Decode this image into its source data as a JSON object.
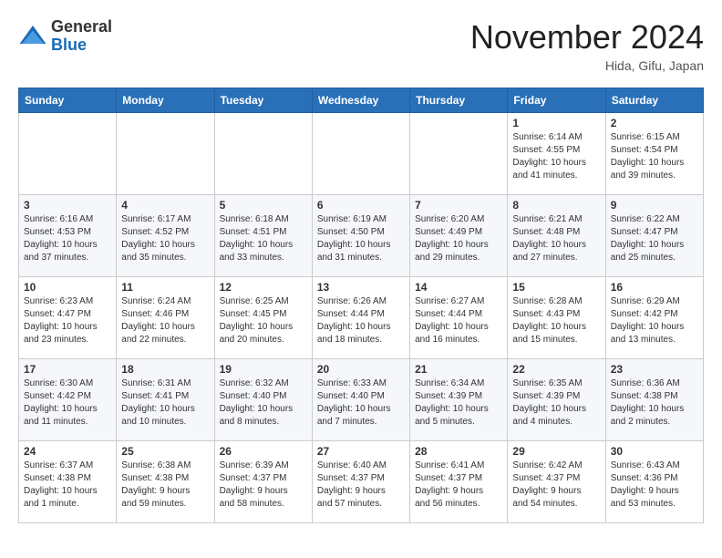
{
  "header": {
    "logo_general": "General",
    "logo_blue": "Blue",
    "month_title": "November 2024",
    "location": "Hida, Gifu, Japan"
  },
  "weekdays": [
    "Sunday",
    "Monday",
    "Tuesday",
    "Wednesday",
    "Thursday",
    "Friday",
    "Saturday"
  ],
  "weeks": [
    [
      {
        "day": "",
        "info": ""
      },
      {
        "day": "",
        "info": ""
      },
      {
        "day": "",
        "info": ""
      },
      {
        "day": "",
        "info": ""
      },
      {
        "day": "",
        "info": ""
      },
      {
        "day": "1",
        "info": "Sunrise: 6:14 AM\nSunset: 4:55 PM\nDaylight: 10 hours\nand 41 minutes."
      },
      {
        "day": "2",
        "info": "Sunrise: 6:15 AM\nSunset: 4:54 PM\nDaylight: 10 hours\nand 39 minutes."
      }
    ],
    [
      {
        "day": "3",
        "info": "Sunrise: 6:16 AM\nSunset: 4:53 PM\nDaylight: 10 hours\nand 37 minutes."
      },
      {
        "day": "4",
        "info": "Sunrise: 6:17 AM\nSunset: 4:52 PM\nDaylight: 10 hours\nand 35 minutes."
      },
      {
        "day": "5",
        "info": "Sunrise: 6:18 AM\nSunset: 4:51 PM\nDaylight: 10 hours\nand 33 minutes."
      },
      {
        "day": "6",
        "info": "Sunrise: 6:19 AM\nSunset: 4:50 PM\nDaylight: 10 hours\nand 31 minutes."
      },
      {
        "day": "7",
        "info": "Sunrise: 6:20 AM\nSunset: 4:49 PM\nDaylight: 10 hours\nand 29 minutes."
      },
      {
        "day": "8",
        "info": "Sunrise: 6:21 AM\nSunset: 4:48 PM\nDaylight: 10 hours\nand 27 minutes."
      },
      {
        "day": "9",
        "info": "Sunrise: 6:22 AM\nSunset: 4:47 PM\nDaylight: 10 hours\nand 25 minutes."
      }
    ],
    [
      {
        "day": "10",
        "info": "Sunrise: 6:23 AM\nSunset: 4:47 PM\nDaylight: 10 hours\nand 23 minutes."
      },
      {
        "day": "11",
        "info": "Sunrise: 6:24 AM\nSunset: 4:46 PM\nDaylight: 10 hours\nand 22 minutes."
      },
      {
        "day": "12",
        "info": "Sunrise: 6:25 AM\nSunset: 4:45 PM\nDaylight: 10 hours\nand 20 minutes."
      },
      {
        "day": "13",
        "info": "Sunrise: 6:26 AM\nSunset: 4:44 PM\nDaylight: 10 hours\nand 18 minutes."
      },
      {
        "day": "14",
        "info": "Sunrise: 6:27 AM\nSunset: 4:44 PM\nDaylight: 10 hours\nand 16 minutes."
      },
      {
        "day": "15",
        "info": "Sunrise: 6:28 AM\nSunset: 4:43 PM\nDaylight: 10 hours\nand 15 minutes."
      },
      {
        "day": "16",
        "info": "Sunrise: 6:29 AM\nSunset: 4:42 PM\nDaylight: 10 hours\nand 13 minutes."
      }
    ],
    [
      {
        "day": "17",
        "info": "Sunrise: 6:30 AM\nSunset: 4:42 PM\nDaylight: 10 hours\nand 11 minutes."
      },
      {
        "day": "18",
        "info": "Sunrise: 6:31 AM\nSunset: 4:41 PM\nDaylight: 10 hours\nand 10 minutes."
      },
      {
        "day": "19",
        "info": "Sunrise: 6:32 AM\nSunset: 4:40 PM\nDaylight: 10 hours\nand 8 minutes."
      },
      {
        "day": "20",
        "info": "Sunrise: 6:33 AM\nSunset: 4:40 PM\nDaylight: 10 hours\nand 7 minutes."
      },
      {
        "day": "21",
        "info": "Sunrise: 6:34 AM\nSunset: 4:39 PM\nDaylight: 10 hours\nand 5 minutes."
      },
      {
        "day": "22",
        "info": "Sunrise: 6:35 AM\nSunset: 4:39 PM\nDaylight: 10 hours\nand 4 minutes."
      },
      {
        "day": "23",
        "info": "Sunrise: 6:36 AM\nSunset: 4:38 PM\nDaylight: 10 hours\nand 2 minutes."
      }
    ],
    [
      {
        "day": "24",
        "info": "Sunrise: 6:37 AM\nSunset: 4:38 PM\nDaylight: 10 hours\nand 1 minute."
      },
      {
        "day": "25",
        "info": "Sunrise: 6:38 AM\nSunset: 4:38 PM\nDaylight: 9 hours\nand 59 minutes."
      },
      {
        "day": "26",
        "info": "Sunrise: 6:39 AM\nSunset: 4:37 PM\nDaylight: 9 hours\nand 58 minutes."
      },
      {
        "day": "27",
        "info": "Sunrise: 6:40 AM\nSunset: 4:37 PM\nDaylight: 9 hours\nand 57 minutes."
      },
      {
        "day": "28",
        "info": "Sunrise: 6:41 AM\nSunset: 4:37 PM\nDaylight: 9 hours\nand 56 minutes."
      },
      {
        "day": "29",
        "info": "Sunrise: 6:42 AM\nSunset: 4:37 PM\nDaylight: 9 hours\nand 54 minutes."
      },
      {
        "day": "30",
        "info": "Sunrise: 6:43 AM\nSunset: 4:36 PM\nDaylight: 9 hours\nand 53 minutes."
      }
    ]
  ]
}
